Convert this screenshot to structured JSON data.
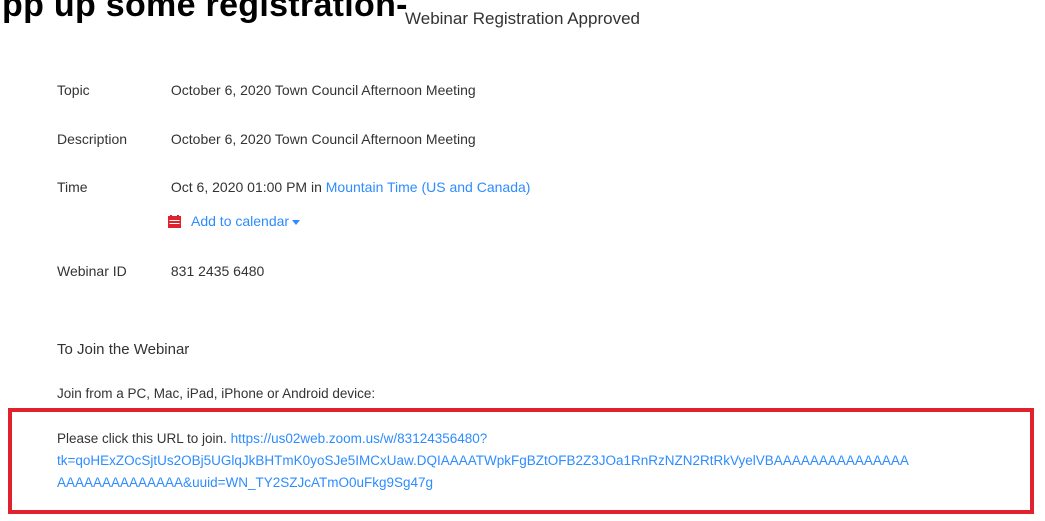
{
  "cropped_heading": "pp up some registration-",
  "card": {
    "title": "Webinar Registration Approved",
    "topic": {
      "label": "Topic",
      "value": "October 6, 2020 Town Council Afternoon Meeting"
    },
    "description": {
      "label": "Description",
      "value": "October 6, 2020 Town Council Afternoon Meeting"
    },
    "time": {
      "label": "Time",
      "value": "Oct 6, 2020 01:00 PM in",
      "timezone": "Mountain Time (US and Canada)"
    },
    "calendar": {
      "label": "Add to calendar",
      "icon": "calendar-icon"
    },
    "webinar_id": {
      "label": "Webinar ID",
      "value": "831 2435 6480"
    }
  },
  "join": {
    "heading": "To Join the Webinar",
    "devices": "Join from a PC, Mac, iPad, iPhone or Android device:",
    "instruction": "Please click this URL to join.",
    "url_line1": "https://us02web.zoom.us/w/83124356480?",
    "url_line2": "tk=qoHExZOcSjtUs2OBj5UGlqJkBHTmK0yoSJe5IMCxUaw.DQIAAAATWpkFgBZtOFB2Z3JOa1RnRzNZN2RtRkVyelVBAAAAAAAAAAAAAAA",
    "url_line3": "AAAAAAAAAAAAAA&uuid=WN_TY2SZJcATmO0uFkg9Sg47g"
  },
  "colors": {
    "link": "#2d8cff",
    "highlight_border": "#e0222f",
    "calendar_icon": "#e0222f"
  }
}
